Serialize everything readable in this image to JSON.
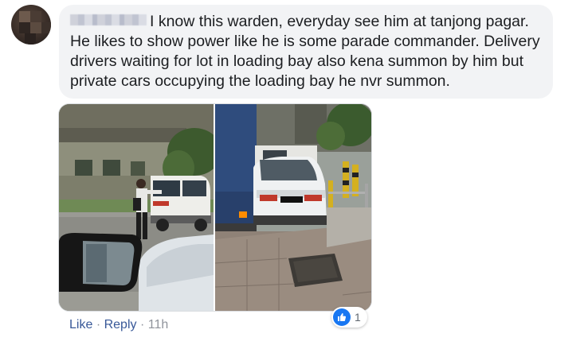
{
  "comment": {
    "author": "",
    "text": "I know this warden, everyday see him at tanjong pagar. He likes to show power like he is some parade commander. Delivery drivers waiting for lot in loading bay also kena summon by him but private cars occupying the loading bay he nvr summon."
  },
  "photos": [
    {
      "id": "photo-left"
    },
    {
      "id": "photo-right"
    }
  ],
  "reactions": {
    "type": "like",
    "count": "1"
  },
  "actions": {
    "like_label": "Like",
    "separator": "·",
    "reply_label": "Reply",
    "timestamp": "11h"
  },
  "colors": {
    "bubble_bg": "#f2f3f5",
    "link": "#385898",
    "like_blue": "#1877f2",
    "meta_gray": "#90949c"
  }
}
